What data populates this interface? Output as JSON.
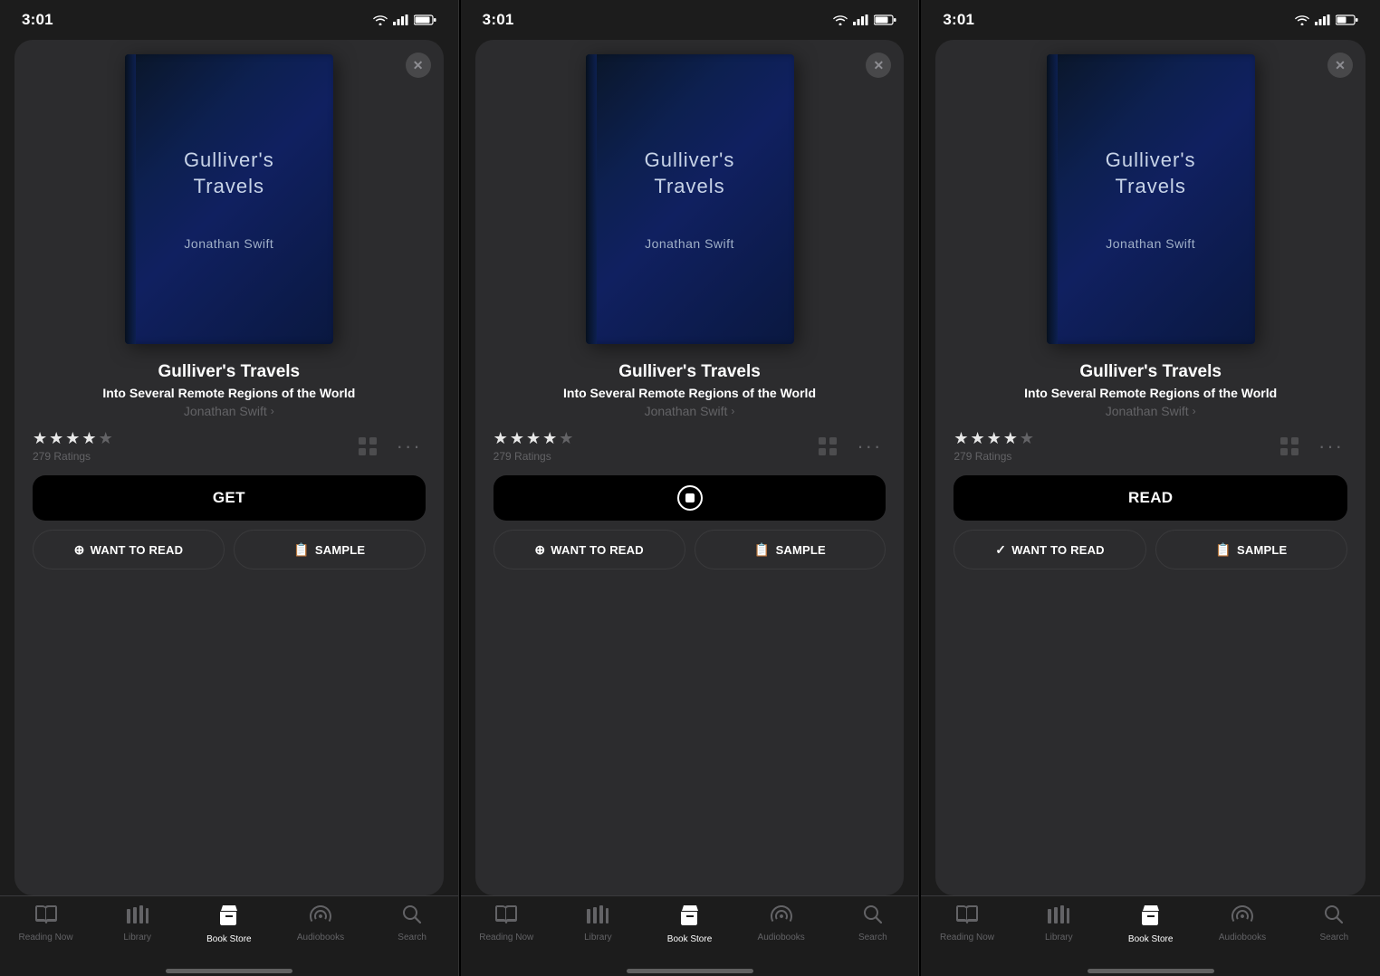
{
  "panels": [
    {
      "id": "panel-1",
      "status_time": "3:01",
      "close_label": "×",
      "book": {
        "title_cover_line1": "Gulliver's",
        "title_cover_line2": "Travels",
        "author_cover": "Jonathan Swift",
        "title_main": "Gulliver's Travels",
        "subtitle": "Into Several Remote Regions of the World",
        "author": "Jonathan Swift",
        "ratings_count": "279 Ratings",
        "stars": [
          true,
          true,
          true,
          true,
          false
        ]
      },
      "primary_button": {
        "label": "GET",
        "type": "black"
      },
      "want_to_read_label": "WANT TO READ",
      "sample_label": "SAMPLE",
      "nav": {
        "items": [
          {
            "label": "Reading Now",
            "icon": "📖",
            "active": false
          },
          {
            "label": "Library",
            "icon": "📊",
            "active": false
          },
          {
            "label": "Book Store",
            "icon": "🛍",
            "active": true
          },
          {
            "label": "Audiobooks",
            "icon": "🎧",
            "active": false
          },
          {
            "label": "Search",
            "icon": "🔍",
            "active": false
          }
        ]
      }
    },
    {
      "id": "panel-2",
      "status_time": "3:01",
      "close_label": "×",
      "book": {
        "title_cover_line1": "Gulliver's",
        "title_cover_line2": "Travels",
        "author_cover": "Jonathan Swift",
        "title_main": "Gulliver's Travels",
        "subtitle": "Into Several Remote Regions of the World",
        "author": "Jonathan Swift",
        "ratings_count": "279 Ratings",
        "stars": [
          true,
          true,
          true,
          true,
          false
        ]
      },
      "primary_button": {
        "label": "stop",
        "type": "stop"
      },
      "want_to_read_label": "WANT TO READ",
      "sample_label": "SAMPLE",
      "nav": {
        "items": [
          {
            "label": "Reading Now",
            "icon": "📖",
            "active": false
          },
          {
            "label": "Library",
            "icon": "📊",
            "active": false
          },
          {
            "label": "Book Store",
            "icon": "🛍",
            "active": true
          },
          {
            "label": "Audiobooks",
            "icon": "🎧",
            "active": false
          },
          {
            "label": "Search",
            "icon": "🔍",
            "active": false
          }
        ]
      }
    },
    {
      "id": "panel-3",
      "status_time": "3:01",
      "close_label": "×",
      "book": {
        "title_cover_line1": "Gulliver's",
        "title_cover_line2": "Travels",
        "author_cover": "Jonathan Swift",
        "title_main": "Gulliver's Travels",
        "subtitle": "Into Several Remote Regions of the World",
        "author": "Jonathan Swift",
        "ratings_count": "279 Ratings",
        "stars": [
          true,
          true,
          true,
          true,
          false
        ]
      },
      "primary_button": {
        "label": "READ",
        "type": "black"
      },
      "want_to_read_label": "WANT TO READ",
      "want_to_read_checked": true,
      "sample_label": "SAMPLE",
      "nav": {
        "items": [
          {
            "label": "Reading Now",
            "icon": "📖",
            "active": false
          },
          {
            "label": "Library",
            "icon": "📊",
            "active": false
          },
          {
            "label": "Book Store",
            "icon": "🛍",
            "active": true
          },
          {
            "label": "Audiobooks",
            "icon": "🎧",
            "active": false
          },
          {
            "label": "Search",
            "icon": "🔍",
            "active": false
          }
        ]
      }
    }
  ]
}
